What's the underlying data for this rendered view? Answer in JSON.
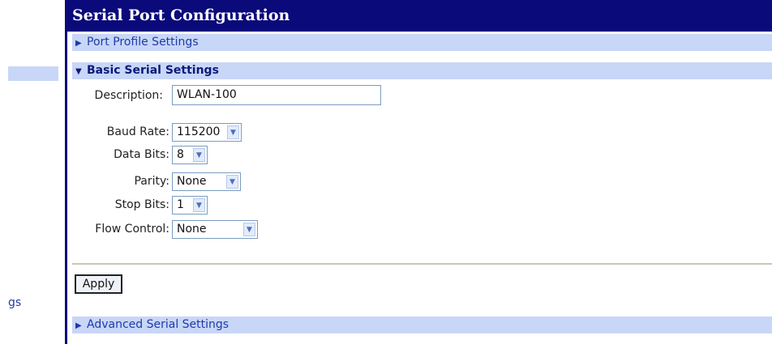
{
  "nav": {
    "partial_link": "gs"
  },
  "page": {
    "title": "Serial Port Configuration"
  },
  "sections": {
    "port_profile": {
      "label": "Port Profile Settings"
    },
    "basic": {
      "label": "Basic Serial Settings"
    },
    "advanced": {
      "label": "Advanced Serial Settings"
    }
  },
  "icons": {
    "collapsed": "triangle-right-icon",
    "expanded": "triangle-down-icon"
  },
  "form": {
    "description": {
      "label": "Description:",
      "value": "WLAN-100"
    },
    "baud_rate": {
      "label": "Baud Rate:",
      "value": "115200"
    },
    "data_bits": {
      "label": "Data Bits:",
      "value": "8"
    },
    "parity": {
      "label": "Parity:",
      "value": "None"
    },
    "stop_bits": {
      "label": "Stop Bits:",
      "value": "1"
    },
    "flow_control": {
      "label": "Flow Control:",
      "value": "None"
    },
    "apply_label": "Apply"
  },
  "colors": {
    "header_bg": "#0a0a7a",
    "section_bg": "#c8d6f7",
    "link": "#1f3aa8"
  }
}
